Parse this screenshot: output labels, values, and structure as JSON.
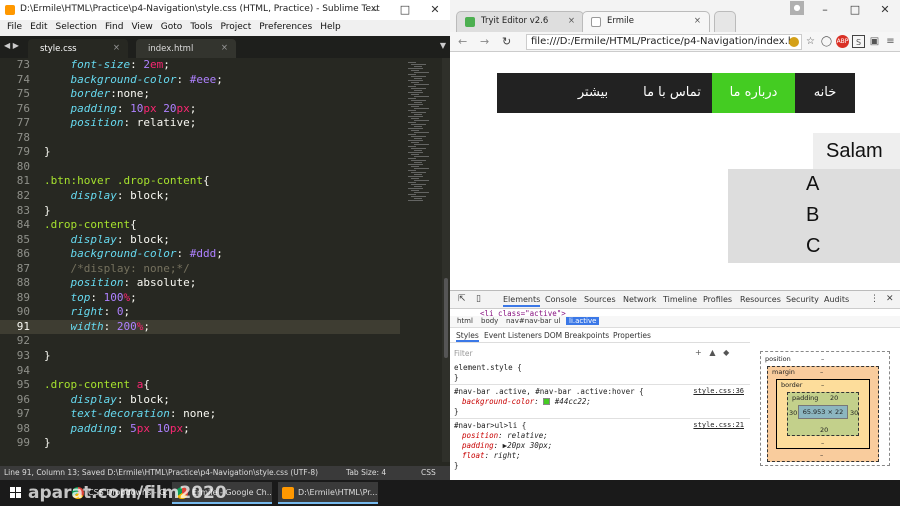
{
  "sublime": {
    "title": "D:\\Ermile\\HTML\\Practice\\p4-Navigation\\style.css (HTML, Practice) - Sublime Text",
    "menu": [
      "File",
      "Edit",
      "Selection",
      "Find",
      "View",
      "Goto",
      "Tools",
      "Project",
      "Preferences",
      "Help"
    ],
    "tabs": [
      {
        "label": "style.css",
        "active": true
      },
      {
        "label": "index.html",
        "active": false
      }
    ],
    "current_line": 91,
    "lines": [
      {
        "n": "73",
        "tokens": [
          [
            "    ",
            "pl"
          ],
          [
            "font-size",
            "prop"
          ],
          [
            ": ",
            "pl"
          ],
          [
            "2",
            "num"
          ],
          [
            "em",
            "kw"
          ],
          [
            ";",
            "pl"
          ]
        ]
      },
      {
        "n": "74",
        "tokens": [
          [
            "    ",
            "pl"
          ],
          [
            "background-color",
            "prop"
          ],
          [
            ": ",
            "pl"
          ],
          [
            "#eee",
            "num"
          ],
          [
            ";",
            "pl"
          ]
        ]
      },
      {
        "n": "75",
        "tokens": [
          [
            "    ",
            "pl"
          ],
          [
            "border",
            "prop"
          ],
          [
            ":",
            "pl"
          ],
          [
            "none",
            "val"
          ],
          [
            ";",
            "pl"
          ]
        ]
      },
      {
        "n": "76",
        "tokens": [
          [
            "    ",
            "pl"
          ],
          [
            "padding",
            "prop"
          ],
          [
            ": ",
            "pl"
          ],
          [
            "10",
            "num"
          ],
          [
            "px",
            "kw"
          ],
          [
            " ",
            "pl"
          ],
          [
            "20",
            "num"
          ],
          [
            "px",
            "kw"
          ],
          [
            ";",
            "pl"
          ]
        ]
      },
      {
        "n": "77",
        "tokens": [
          [
            "    ",
            "pl"
          ],
          [
            "position",
            "prop"
          ],
          [
            ": ",
            "pl"
          ],
          [
            "relative",
            "val"
          ],
          [
            ";",
            "pl"
          ]
        ]
      },
      {
        "n": "78",
        "tokens": []
      },
      {
        "n": "79",
        "tokens": [
          [
            "}",
            "pl"
          ]
        ]
      },
      {
        "n": "80",
        "tokens": []
      },
      {
        "n": "81",
        "tokens": [
          [
            ".btn:hover .drop-content",
            "sel"
          ],
          [
            "{",
            "pl"
          ]
        ]
      },
      {
        "n": "82",
        "tokens": [
          [
            "    ",
            "pl"
          ],
          [
            "display",
            "prop"
          ],
          [
            ": ",
            "pl"
          ],
          [
            "block",
            "val"
          ],
          [
            ";",
            "pl"
          ]
        ]
      },
      {
        "n": "83",
        "tokens": [
          [
            "}",
            "pl"
          ]
        ]
      },
      {
        "n": "84",
        "tokens": [
          [
            ".drop-content",
            "sel"
          ],
          [
            "{",
            "pl"
          ]
        ]
      },
      {
        "n": "85",
        "tokens": [
          [
            "    ",
            "pl"
          ],
          [
            "display",
            "prop"
          ],
          [
            ": ",
            "pl"
          ],
          [
            "block",
            "val"
          ],
          [
            ";",
            "pl"
          ]
        ]
      },
      {
        "n": "86",
        "tokens": [
          [
            "    ",
            "pl"
          ],
          [
            "background-color",
            "prop"
          ],
          [
            ": ",
            "pl"
          ],
          [
            "#ddd",
            "num"
          ],
          [
            ";",
            "pl"
          ]
        ]
      },
      {
        "n": "87",
        "tokens": [
          [
            "    ",
            "pl"
          ],
          [
            "/*display: none;*/",
            "cmt"
          ]
        ]
      },
      {
        "n": "88",
        "tokens": [
          [
            "    ",
            "pl"
          ],
          [
            "position",
            "prop"
          ],
          [
            ": ",
            "pl"
          ],
          [
            "absolute",
            "val"
          ],
          [
            ";",
            "pl"
          ]
        ]
      },
      {
        "n": "89",
        "tokens": [
          [
            "    ",
            "pl"
          ],
          [
            "top",
            "prop"
          ],
          [
            ": ",
            "pl"
          ],
          [
            "100",
            "num"
          ],
          [
            "%",
            "kw"
          ],
          [
            ";",
            "pl"
          ]
        ]
      },
      {
        "n": "90",
        "tokens": [
          [
            "    ",
            "pl"
          ],
          [
            "right",
            "prop"
          ],
          [
            ": ",
            "pl"
          ],
          [
            "0",
            "num"
          ],
          [
            ";",
            "pl"
          ]
        ]
      },
      {
        "n": "91",
        "tokens": [
          [
            "    ",
            "pl"
          ],
          [
            "width",
            "prop"
          ],
          [
            ": ",
            "pl"
          ],
          [
            "200",
            "num"
          ],
          [
            "%",
            "kw"
          ],
          [
            ";",
            "pl"
          ]
        ]
      },
      {
        "n": "92",
        "tokens": []
      },
      {
        "n": "93",
        "tokens": [
          [
            "}",
            "pl"
          ]
        ]
      },
      {
        "n": "94",
        "tokens": []
      },
      {
        "n": "95",
        "tokens": [
          [
            ".drop-content ",
            "sel"
          ],
          [
            "a",
            "kw"
          ],
          [
            "{",
            "pl"
          ]
        ]
      },
      {
        "n": "96",
        "tokens": [
          [
            "    ",
            "pl"
          ],
          [
            "display",
            "prop"
          ],
          [
            ": ",
            "pl"
          ],
          [
            "block",
            "val"
          ],
          [
            ";",
            "pl"
          ]
        ]
      },
      {
        "n": "97",
        "tokens": [
          [
            "    ",
            "pl"
          ],
          [
            "text-decoration",
            "prop"
          ],
          [
            ": ",
            "pl"
          ],
          [
            "none",
            "val"
          ],
          [
            ";",
            "pl"
          ]
        ]
      },
      {
        "n": "98",
        "tokens": [
          [
            "    ",
            "pl"
          ],
          [
            "padding",
            "prop"
          ],
          [
            ": ",
            "pl"
          ],
          [
            "5",
            "num"
          ],
          [
            "px",
            "kw"
          ],
          [
            " ",
            "pl"
          ],
          [
            "10",
            "num"
          ],
          [
            "px",
            "kw"
          ],
          [
            ";",
            "pl"
          ]
        ]
      },
      {
        "n": "99",
        "tokens": [
          [
            "}",
            "pl"
          ]
        ]
      }
    ],
    "status_left": "Line 91, Column 13; Saved D:\\Ermile\\HTML\\Practice\\p4-Navigation\\style.css (UTF-8)",
    "status_tab": "Tab Size: 4",
    "status_syntax": "CSS"
  },
  "chrome": {
    "tabs": [
      {
        "label": "Tryit Editor v2.6",
        "active": false
      },
      {
        "label": "Ermile",
        "active": true
      }
    ],
    "url": "file:///D:/Ermile/HTML/Practice/p4-Navigation/index.h",
    "page": {
      "nav_items": [
        "خانه",
        "درباره ما",
        "تماس با ما",
        "بیشتر"
      ],
      "active_nav": "درباره ما",
      "active_color": "#44cc22",
      "navbar_bg": "#222222",
      "button_label": "Salam",
      "dropdown_items": [
        "A",
        "B",
        "C"
      ]
    },
    "devtools": {
      "tabs": [
        "Elements",
        "Console",
        "Sources",
        "Network",
        "Timeline",
        "Profiles",
        "Resources",
        "Security",
        "Audits"
      ],
      "active_tab": "Elements",
      "dom_line": "<li class=\"active\">",
      "breadcrumbs": [
        "html",
        "body",
        "nav#nav-bar",
        "ul",
        "li.active"
      ],
      "subtabs": [
        "Styles",
        "Event Listeners",
        "DOM Breakpoints",
        "Properties"
      ],
      "filter_placeholder": "Filter",
      "rules": [
        {
          "selector": "element.style {",
          "source": "",
          "props": []
        },
        {
          "selector": "#nav-bar .active, #nav-bar .active:hover {",
          "source": "style.css:36",
          "props": [
            {
              "name": "background-color",
              "value": "#44cc22;"
            }
          ]
        },
        {
          "selector": "#nav-bar>ul>li {",
          "source": "style.css:21",
          "props": [
            {
              "name": "position",
              "value": "relative;"
            },
            {
              "name": "padding",
              "value": "▶20px 30px;"
            },
            {
              "name": "float",
              "value": "right;"
            }
          ]
        }
      ],
      "boxmodel": {
        "position_label": "position",
        "margin_label": "margin",
        "border_label": "border",
        "padding_label": "padding",
        "padding_top": "20",
        "padding_bottom": "20",
        "padding_left": "30",
        "padding_right": "30",
        "content": "65.953 × 22",
        "dash": "–"
      }
    }
  },
  "taskbar": {
    "items": [
      {
        "label": "CSS Dropdowns - G...",
        "icon": "chrome-icon"
      },
      {
        "label": "Ermile - Google Ch...",
        "icon": "chrome-icon"
      },
      {
        "label": "D:\\Ermile\\HTML\\Pr...",
        "icon": "sublime-icon"
      }
    ],
    "watermark": "aparat.com/film2020"
  }
}
